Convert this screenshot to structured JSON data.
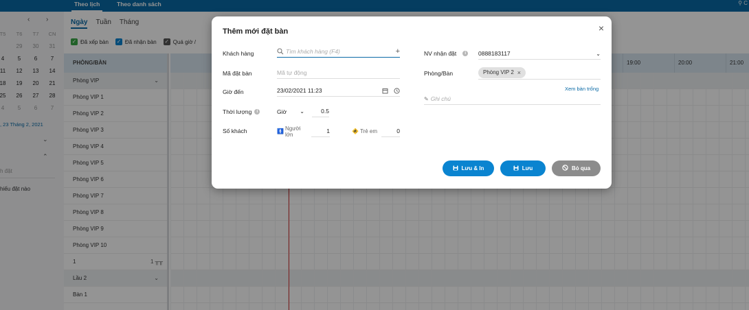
{
  "topbar": {
    "tab_calendar": "Theo lịch",
    "tab_list": "Theo danh sách",
    "location_label": "C"
  },
  "calendar": {
    "weekdays": [
      "T5",
      "T6",
      "T7",
      "CN"
    ],
    "weeks": [
      [
        "29",
        "30",
        "31"
      ],
      [
        "4",
        "5",
        "6",
        "7"
      ],
      [
        "11",
        "12",
        "13",
        "14"
      ],
      [
        "18",
        "19",
        "20",
        "21"
      ],
      [
        "25",
        "26",
        "27",
        "28"
      ],
      [
        "4",
        "5",
        "6",
        "7"
      ]
    ],
    "selected_date": ", 23 Tháng 2, 2021",
    "search_placeholder": "h đặt",
    "empty_message": "hiếu đặt nào"
  },
  "view_tabs": [
    "Ngày",
    "Tuần",
    "Tháng"
  ],
  "filters": [
    "Đã xếp bàn",
    "Đã nhận bàn",
    "Quá giờ /"
  ],
  "rooms": {
    "header": "PHÒNG/BÀN",
    "items": [
      {
        "label": "Phòng VIP",
        "group": true
      },
      {
        "label": "Phòng VIP 1"
      },
      {
        "label": "Phòng VIP 2"
      },
      {
        "label": "Phòng VIP 3"
      },
      {
        "label": "Phòng VIP 4"
      },
      {
        "label": "Phòng VIP 5"
      },
      {
        "label": "Phòng VIP 6"
      },
      {
        "label": "Phòng VIP 7"
      },
      {
        "label": "Phòng VIP 8"
      },
      {
        "label": "Phòng VIP 9"
      },
      {
        "label": "Phòng VIP 10"
      },
      {
        "label": "1",
        "extra": "1"
      },
      {
        "label": "Lầu 2",
        "group": true
      },
      {
        "label": "Bàn 1"
      }
    ]
  },
  "timeline": {
    "hours": [
      "19:00",
      "20:00",
      "21:00"
    ]
  },
  "modal": {
    "title": "Thêm mới đặt bàn",
    "customer": {
      "label": "Khách hàng",
      "placeholder": "Tìm khách hàng (F4)"
    },
    "booking_code": {
      "label": "Mã đặt bàn",
      "placeholder": "Mã tự động"
    },
    "arrival": {
      "label": "Giờ đến",
      "value": "23/02/2021 11:23"
    },
    "duration": {
      "label": "Thời lượng",
      "unit": "Giờ",
      "value": "0.5"
    },
    "guests": {
      "label": "Số khách",
      "adults_label": "Người lớn",
      "adults": "1",
      "children_label": "Trẻ em",
      "children": "0"
    },
    "staff": {
      "label": "NV nhận đặt",
      "value": "0888183117"
    },
    "room": {
      "label": "Phòng/Bàn",
      "chip": "Phòng VIP 2"
    },
    "view_empty": "Xem bàn trống",
    "note_placeholder": "Ghi chú",
    "buttons": {
      "save_print": "Lưu & In",
      "save": "Lưu",
      "skip": "Bỏ qua"
    }
  },
  "colors": {
    "primary": "#0a84d0",
    "brand": "#0a6aa6",
    "now_line": "#d32f2f",
    "skip": "#8c8c8c"
  }
}
